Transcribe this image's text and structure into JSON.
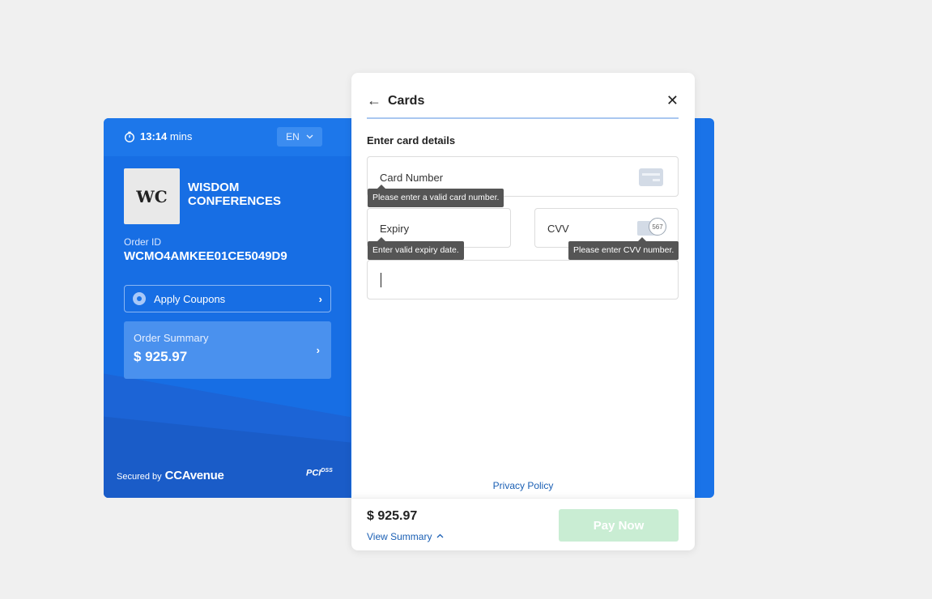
{
  "timer": {
    "value": "13:14",
    "unit": "mins"
  },
  "language": {
    "selected": "EN"
  },
  "merchant": {
    "logo_text": "WC",
    "name": "WISDOM CONFERENCES"
  },
  "order": {
    "label": "Order ID",
    "id": "WCMO4AMKEE01CE5049D9"
  },
  "coupons": {
    "label": "Apply Coupons"
  },
  "summary": {
    "label": "Order Summary",
    "amount": "$ 925.97"
  },
  "security": {
    "secured_by": "Secured by",
    "provider": "CCAvenue",
    "pci": "PCI",
    "dss": "DSS"
  },
  "modal": {
    "title": "Cards",
    "subheading": "Enter card details",
    "fields": {
      "card_number": {
        "label": "Card Number",
        "error": "Please enter a valid card number."
      },
      "expiry": {
        "label": "Expiry",
        "error": "Enter valid expiry date."
      },
      "cvv": {
        "label": "CVV",
        "error": "Please enter CVV number.",
        "icon_text": "567"
      },
      "name": {
        "value": ""
      }
    },
    "privacy_policy": "Privacy Policy",
    "footer": {
      "amount": "$ 925.97",
      "view_summary": "View Summary",
      "pay_label": "Pay Now"
    }
  },
  "colors": {
    "primary": "#1a73e8",
    "pay_disabled": "#c9edd3",
    "link": "#1a5fb4",
    "tooltip": "#555555"
  }
}
